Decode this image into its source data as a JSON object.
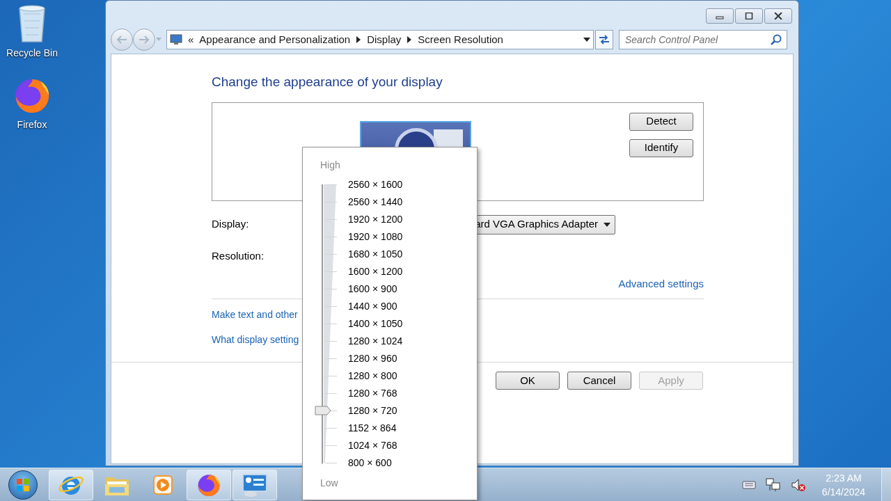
{
  "desktop_icons": [
    {
      "label": "Recycle Bin",
      "kind": "recycle"
    },
    {
      "label": "Firefox",
      "kind": "firefox"
    }
  ],
  "window": {
    "breadcrumb": {
      "overflow": "«",
      "items": [
        "Appearance and Personalization",
        "Display",
        "Screen Resolution"
      ]
    },
    "search": {
      "placeholder": "Search Control Panel"
    },
    "heading": "Change the appearance of your display",
    "side_buttons": [
      "Detect",
      "Identify"
    ],
    "display_label": "Display:",
    "display_value": "ard VGA Graphics Adapter",
    "resolution_label": "Resolution:",
    "advanced_link": "Advanced settings",
    "links": [
      "Make text and other",
      "What display setting"
    ],
    "buttons": [
      {
        "label": "OK",
        "disabled": false
      },
      {
        "label": "Cancel",
        "disabled": false
      },
      {
        "label": "Apply",
        "disabled": true
      }
    ]
  },
  "resolution_menu": {
    "high_label": "High",
    "low_label": "Low",
    "level": 0.1875,
    "options": [
      "2560 × 1600",
      "2560 × 1440",
      "1920 × 1200",
      "1920 × 1080",
      "1680 × 1050",
      "1600 × 1200",
      "1600 × 900",
      "1440 × 900",
      "1400 × 1050",
      "1280 × 1024",
      "1280 × 960",
      "1280 × 800",
      "1280 × 768",
      "1280 × 720",
      "1152 × 864",
      "1024 × 768",
      "800 × 600"
    ]
  },
  "taskbar": {
    "items": [
      {
        "kind": "ie",
        "running": true
      },
      {
        "kind": "explorer",
        "running": false
      },
      {
        "kind": "media",
        "running": false
      },
      {
        "kind": "firefox",
        "running": true
      },
      {
        "kind": "control-panel",
        "running": true
      }
    ],
    "time": "2:23 AM",
    "date": "6/14/2024"
  }
}
